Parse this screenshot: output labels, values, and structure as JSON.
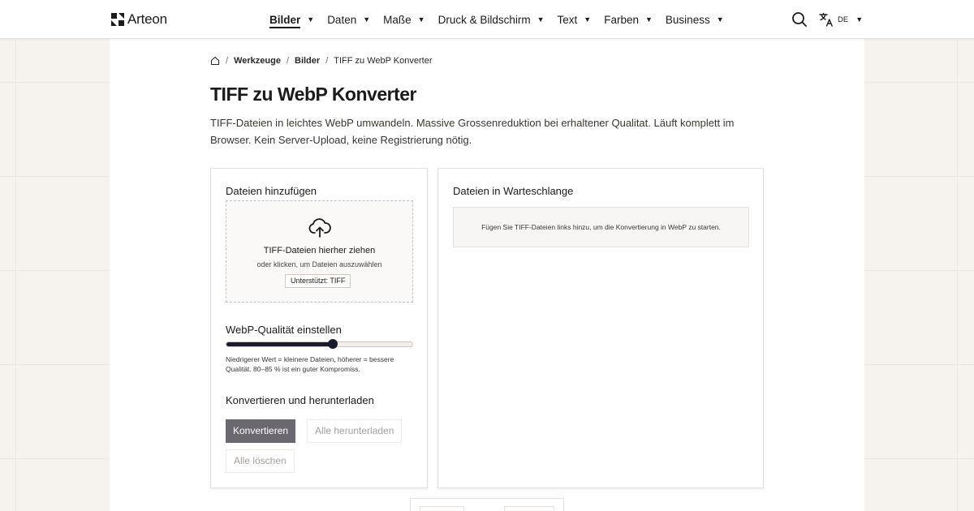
{
  "brand": {
    "name": "Arteon"
  },
  "nav": {
    "items": [
      {
        "label": "Bilder",
        "active": true
      },
      {
        "label": "Daten"
      },
      {
        "label": "Maße"
      },
      {
        "label": "Druck & Bildschirm"
      },
      {
        "label": "Text"
      },
      {
        "label": "Farben"
      },
      {
        "label": "Business"
      }
    ],
    "caret": "▼"
  },
  "header": {
    "language": "DE",
    "search_icon": "search-icon",
    "language_icon": "translate-icon"
  },
  "breadcrumb": {
    "items": [
      "Werkzeuge",
      "Bilder"
    ],
    "current": "TIFF zu WebP Konverter",
    "separator": "/"
  },
  "page": {
    "title": "TIFF zu WebP Konverter",
    "description": "TIFF-Dateien in leichtes WebP umwandeln. Massive Grossenreduktion bei erhaltener Qualitat. Läuft komplett im Browser. Kein Server-Upload, keine Registrierung nötig."
  },
  "upload": {
    "heading": "Dateien hinzufügen",
    "dropzone_title": "TIFF-Dateien hierher ziehen",
    "dropzone_subtitle": "oder klicken, um Dateien auszuwählen",
    "supported_badge": "Unterstützt: TIFF",
    "icon": "cloud-upload-icon"
  },
  "quality": {
    "heading": "WebP-Qualität einstellen",
    "value_fraction": 0.57,
    "hint": "Niedrigerer Wert = kleinere Dateien, höherer = bessere Qualität. 80–85 % ist ein guter Kompromiss."
  },
  "actions": {
    "heading": "Konvertieren und herunterladen",
    "convert_label": "Konvertieren",
    "download_all_label": "Alle herunterladen",
    "clear_all_label": "Alle löschen"
  },
  "queue": {
    "heading": "Dateien in Warteschlange",
    "empty_message": "Fügen Sie TIFF-Dateien links hinzu, um die Konvertierung in WebP zu starten."
  },
  "colors": {
    "accent": "#1b1b2f",
    "primary_button": "#6b6870",
    "background": "#f6f2ee"
  }
}
